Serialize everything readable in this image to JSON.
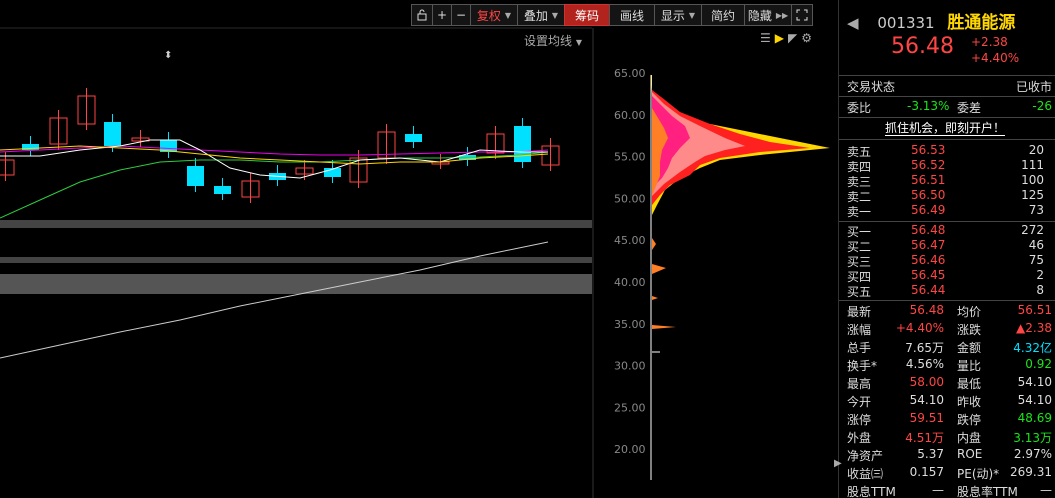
{
  "toolbar": {
    "lock_icon": "lock-icon",
    "plus_icon": "plus-icon",
    "minus_icon": "minus-icon",
    "fuquan": "复权",
    "diejia": "叠加",
    "chouma": "筹码",
    "huaxian": "画线",
    "xianshi": "显示",
    "jianyue": "简约",
    "yincang": "隐藏",
    "expand_icon": "expand-icon"
  },
  "sub_label": "设置均线",
  "chip_toolbar_icons": [
    "lines-icon",
    "flag-icon",
    "cursor-icon",
    "gear-icon"
  ],
  "price_axis": [
    "65.00",
    "60.00",
    "55.00",
    "50.00",
    "45.00",
    "40.00",
    "35.00",
    "30.00",
    "25.00",
    "20.00"
  ],
  "stock": {
    "code": "001331",
    "name": "胜通能源",
    "price": "56.48",
    "change": "+2.38",
    "change_pct": "+4.40%"
  },
  "status": {
    "label": "交易状态",
    "value": "已收市"
  },
  "weibi": {
    "label": "委比",
    "value": "-3.13%",
    "label2": "委差",
    "value2": "-26"
  },
  "banner": "抓住机会，即刻开户！",
  "asks": [
    {
      "label": "卖五",
      "price": "56.53",
      "vol": "20"
    },
    {
      "label": "卖四",
      "price": "56.52",
      "vol": "111"
    },
    {
      "label": "卖三",
      "price": "56.51",
      "vol": "100"
    },
    {
      "label": "卖二",
      "price": "56.50",
      "vol": "125"
    },
    {
      "label": "卖一",
      "price": "56.49",
      "vol": "73"
    }
  ],
  "bids": [
    {
      "label": "买一",
      "price": "56.48",
      "vol": "272"
    },
    {
      "label": "买二",
      "price": "56.47",
      "vol": "46"
    },
    {
      "label": "买三",
      "price": "56.46",
      "vol": "75"
    },
    {
      "label": "买四",
      "price": "56.45",
      "vol": "2"
    },
    {
      "label": "买五",
      "price": "56.44",
      "vol": "8"
    }
  ],
  "stats": [
    {
      "l1": "最新",
      "v1": "56.48",
      "c1": "red",
      "l2": "均价",
      "v2": "56.51",
      "c2": "red"
    },
    {
      "l1": "涨幅",
      "v1": "+4.40%",
      "c1": "red",
      "l2": "涨跌",
      "v2": "▲2.38",
      "c2": "red"
    },
    {
      "l1": "总手",
      "v1": "7.65万",
      "c1": "white",
      "l2": "金额",
      "v2": "4.32亿",
      "c2": "cyan"
    },
    {
      "l1": "换手*",
      "v1": "4.56%",
      "c1": "white",
      "l2": "量比",
      "v2": "0.92",
      "c2": "green"
    },
    {
      "l1": "最高",
      "v1": "58.00",
      "c1": "red",
      "l2": "最低",
      "v2": "54.10",
      "c2": "white"
    },
    {
      "l1": "今开",
      "v1": "54.10",
      "c1": "white",
      "l2": "昨收",
      "v2": "54.10",
      "c2": "white"
    },
    {
      "l1": "涨停",
      "v1": "59.51",
      "c1": "red",
      "l2": "跌停",
      "v2": "48.69",
      "c2": "green"
    },
    {
      "l1": "外盘",
      "v1": "4.51万",
      "c1": "red",
      "l2": "内盘",
      "v2": "3.13万",
      "c2": "green"
    },
    {
      "l1": "净资产",
      "v1": "5.37",
      "c1": "white",
      "l2": "ROE",
      "v2": "2.97%",
      "c2": "white"
    },
    {
      "l1": "收益㈢",
      "v1": "0.157",
      "c1": "white",
      "l2": "PE(动)*",
      "v2": "269.31",
      "c2": "white"
    },
    {
      "l1": "股息TTM",
      "v1": "—",
      "c1": "white",
      "l2": "股息率TTM",
      "v2": "—",
      "c2": "white"
    }
  ],
  "colors": {
    "up": "#ff4545",
    "down": "#00e0ff",
    "accent": "#b3231d",
    "name": "#ffd700"
  }
}
